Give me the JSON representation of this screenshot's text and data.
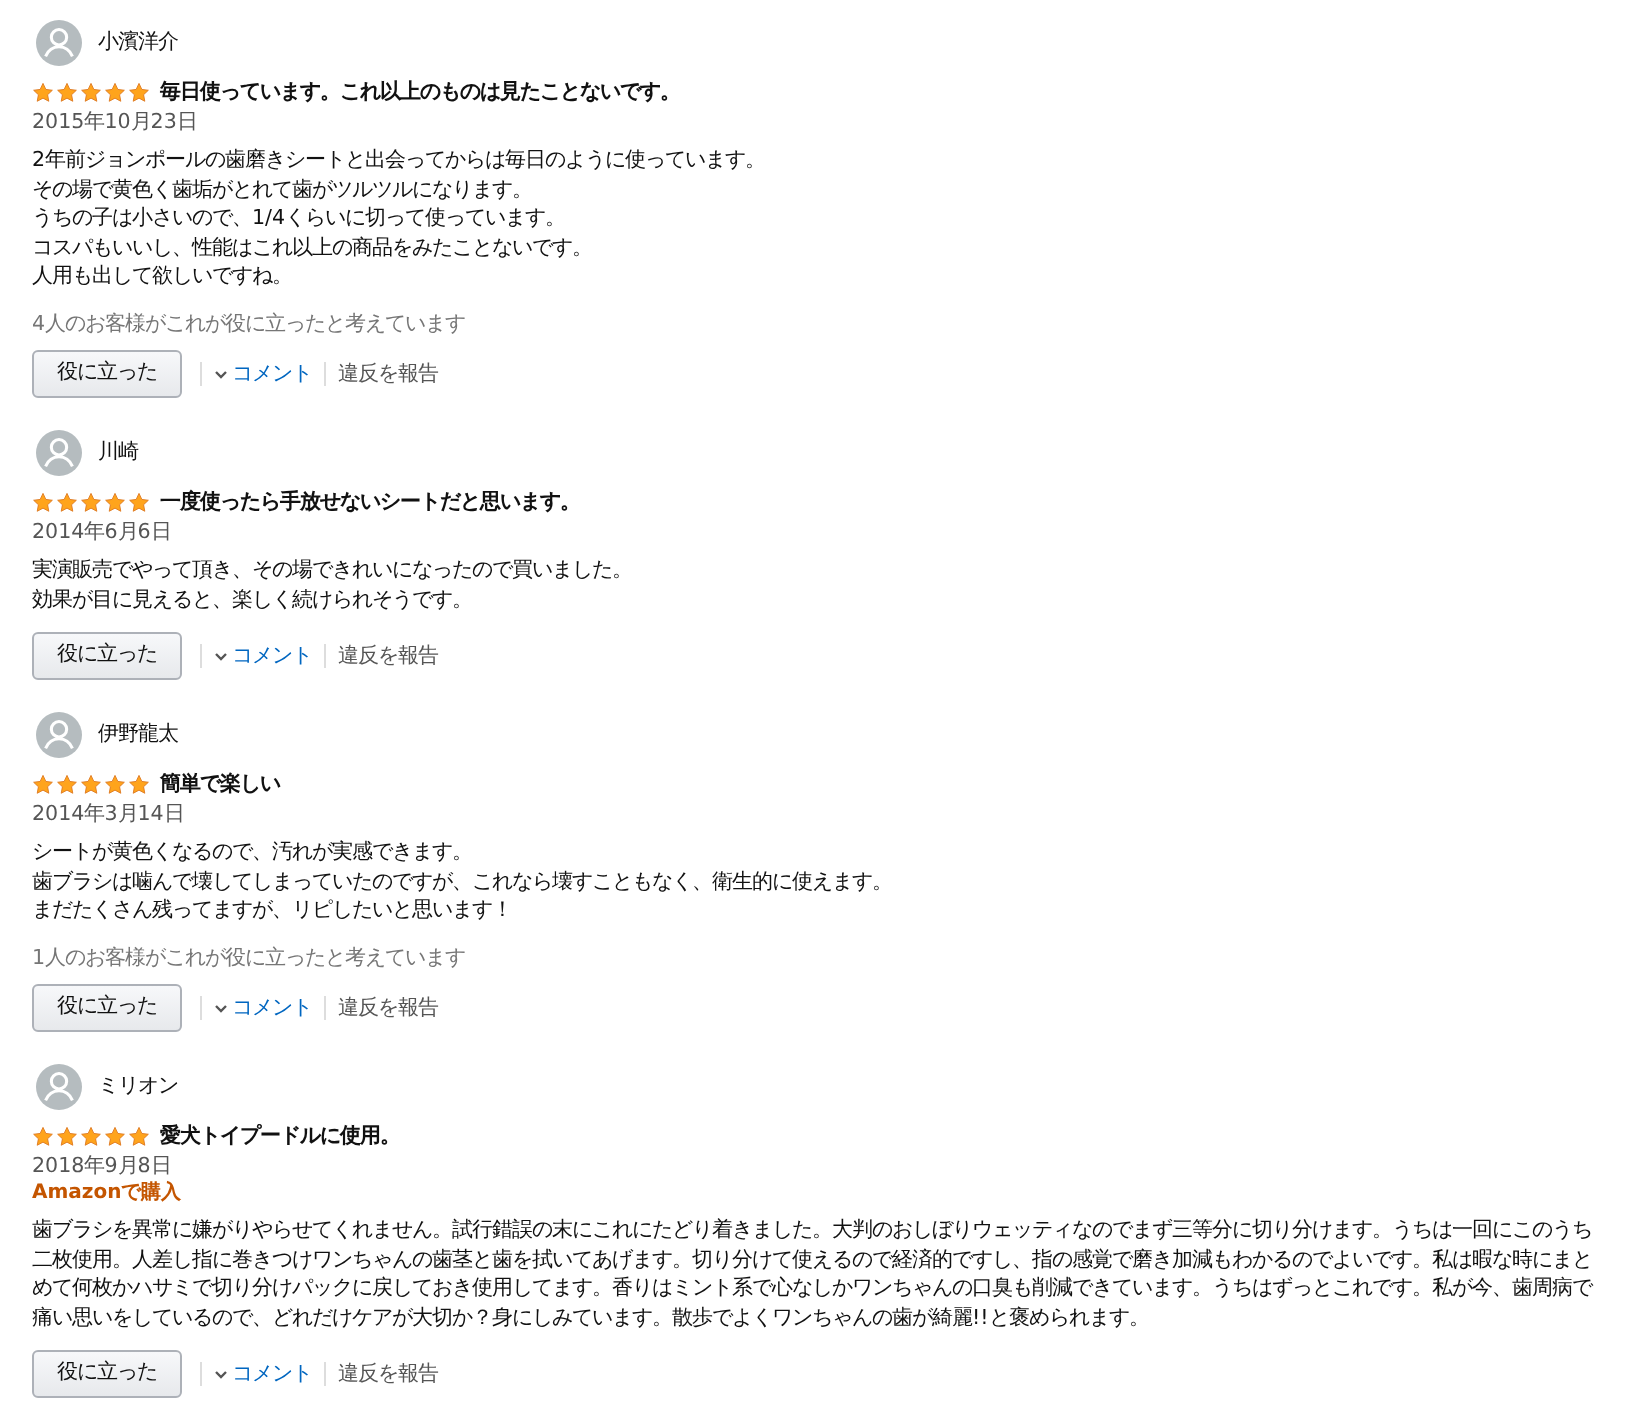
{
  "reviews": [
    {
      "author": "小濱洋介",
      "stars": 5,
      "title": "毎日使っています。これ以上のものは見たことないです。",
      "date": "2015年10月23日",
      "body": [
        "2年前ジョンポールの歯磨きシートと出会ってからは毎日のように使っています。",
        "その場で黄色く歯垢がとれて歯がツルツルになります。",
        "うちの子は小さいので、1/4くらいに切って使っています。",
        "コスパもいいし、性能はこれ以上の商品をみたことないです。",
        "人用も出して欲しいですね。"
      ],
      "helpful": "4人のお客様がこれが役に立ったと考えています",
      "actions": {
        "helpful_button": "役に立った",
        "comment": "コメント",
        "report": "違反を報告"
      }
    },
    {
      "author": "川崎",
      "stars": 5,
      "title": "一度使ったら手放せないシートだと思います。",
      "date": "2014年6月6日",
      "body": [
        "実演販売でやって頂き、その場できれいになったので買いました。",
        "効果が目に見えると、楽しく続けられそうです。"
      ],
      "actions": {
        "helpful_button": "役に立った",
        "comment": "コメント",
        "report": "違反を報告"
      }
    },
    {
      "author": "伊野龍太",
      "stars": 5,
      "title": "簡単で楽しい",
      "date": "2014年3月14日",
      "body": [
        "シートが黄色くなるので、汚れが実感できます。",
        "歯ブラシは噛んで壊してしまっていたのですが、これなら壊すこともなく、衛生的に使えます。",
        "まだたくさん残ってますが、リピしたいと思います！"
      ],
      "helpful": "1人のお客様がこれが役に立ったと考えています",
      "actions": {
        "helpful_button": "役に立った",
        "comment": "コメント",
        "report": "違反を報告"
      }
    },
    {
      "author": "ミリオン",
      "stars": 5,
      "title": "愛犬トイプードルに使用。",
      "date": "2018年9月8日",
      "badge": "Amazonで購入",
      "body": [
        "歯ブラシを異常に嫌がりやらせてくれません。試行錯誤の末にこれにたどり着きました。大判のおしぼりウェッティなのでまず三等分に切り分けます。うちは一回にこのうち二枚使用。人差し指に巻きつけワンちゃんの歯茎と歯を拭いてあげます。切り分けて使えるので経済的ですし、指の感覚で磨き加減もわかるのでよいです。私は暇な時にまとめて何枚かハサミで切り分けパックに戻しておき使用してます。香りはミント系で心なしかワンちゃんの口臭も削減できています。うちはずっとこれです。私が今、歯周病で痛い思いをしているので、どれだけケアが大切か？身にしみています。散歩でよくワンちゃんの歯が綺麗!!と褒められます。"
      ],
      "actions": {
        "helpful_button": "役に立った",
        "comment": "コメント",
        "report": "違反を報告"
      }
    }
  ]
}
